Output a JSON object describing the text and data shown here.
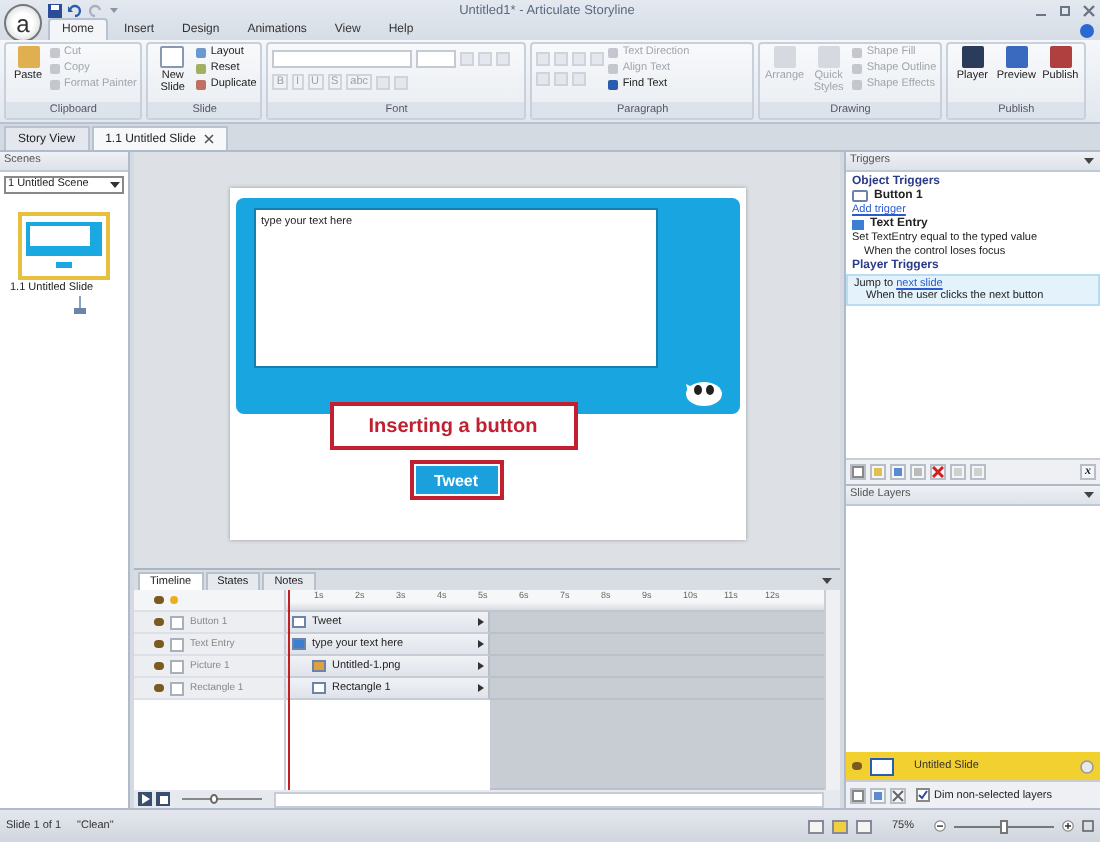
{
  "window": {
    "title": "Untitled1* - Articulate Storyline",
    "logo": "a"
  },
  "ribbon_tabs": [
    {
      "label": "Home",
      "selected": true
    },
    {
      "label": "Insert",
      "selected": false
    },
    {
      "label": "Design",
      "selected": false
    },
    {
      "label": "Animations",
      "selected": false
    },
    {
      "label": "View",
      "selected": false
    },
    {
      "label": "Help",
      "selected": false
    }
  ],
  "ribbon": {
    "clipboard": {
      "label": "Clipboard",
      "paste": "Paste",
      "small": [
        {
          "label": "Cut",
          "disabled": true
        },
        {
          "label": "Copy",
          "disabled": true
        },
        {
          "label": "Format Painter",
          "disabled": true
        }
      ]
    },
    "slide": {
      "label": "Slide",
      "new_slide": "New Slide",
      "small": [
        {
          "label": "Layout",
          "disabled": false
        },
        {
          "label": "Reset",
          "disabled": false
        },
        {
          "label": "Duplicate",
          "disabled": false
        }
      ]
    },
    "font": {
      "label": "Font",
      "buttons": [
        "B",
        "I",
        "U",
        "S",
        "abc"
      ]
    },
    "paragraph": {
      "label": "Paragraph",
      "small": [
        {
          "label": "Text Direction",
          "disabled": true
        },
        {
          "label": "Align Text",
          "disabled": true
        },
        {
          "label": "Find Text",
          "disabled": false
        }
      ]
    },
    "drawing": {
      "label": "Drawing",
      "large": [
        {
          "label": "Arrange",
          "disabled": true
        },
        {
          "label": "Quick Styles",
          "disabled": true
        }
      ],
      "small": [
        {
          "label": "Shape Fill",
          "disabled": true
        },
        {
          "label": "Shape Outline",
          "disabled": true
        },
        {
          "label": "Shape Effects",
          "disabled": true
        }
      ]
    },
    "publish": {
      "label": "Publish",
      "large": [
        {
          "label": "Player",
          "disabled": false
        },
        {
          "label": "Preview",
          "disabled": false
        },
        {
          "label": "Publish",
          "disabled": false
        }
      ]
    }
  },
  "doc_tabs": [
    {
      "label": "Story View",
      "selected": false
    },
    {
      "label": "1.1 Untitled Slide",
      "selected": true
    }
  ],
  "scenes": {
    "title": "Scenes",
    "scene": "1 Untitled Scene",
    "slides": [
      {
        "label": "1.1 Untitled Slide",
        "selected": true
      }
    ]
  },
  "slide": {
    "text_entry": "type your text here",
    "callout": "Inserting a button",
    "button": "Tweet"
  },
  "timeline": {
    "tabs": [
      {
        "label": "Timeline",
        "selected": true
      },
      {
        "label": "States",
        "selected": false
      },
      {
        "label": "Notes",
        "selected": false
      }
    ],
    "ticks": [
      "1s",
      "2s",
      "3s",
      "4s",
      "5s",
      "6s",
      "7s",
      "8s",
      "9s",
      "10s",
      "11s",
      "12s"
    ],
    "rows": [
      {
        "name": "Button 1",
        "label": "Tweet",
        "kind": "button",
        "locked": false
      },
      {
        "name": "Text Entry",
        "label": "type your text here",
        "kind": "entry",
        "locked": false,
        "children": [
          {
            "name": "Picture 1",
            "label": "Untitled-1.png",
            "kind": "picture",
            "locked": false
          },
          {
            "name": "Rectangle 1",
            "label": "Rectangle 1",
            "kind": "shape",
            "locked": false
          }
        ]
      }
    ],
    "zoom": {
      "level": 0.4
    }
  },
  "triggers": {
    "title": "Triggers",
    "object_heading": "Object Triggers",
    "object": "Button 1",
    "add_link": "Add trigger",
    "entry": "Text Entry",
    "entry_action": "Set TextEntry equal to the typed value",
    "entry_condition": "When the control loses focus",
    "player_heading": "Player Triggers",
    "player": [
      {
        "action": "Jump to",
        "link": "next slide",
        "condition": "When the user clicks the next button",
        "selected": true
      }
    ],
    "variables_button": "x"
  },
  "layers": {
    "title": "Slide Layers",
    "items": [
      {
        "label": "Untitled Slide",
        "selected": true
      }
    ],
    "dim": {
      "label": "Dim non-selected layers",
      "checked": true
    }
  },
  "status": {
    "slide": "Slide 1 of 1",
    "theme": "\"Clean\"",
    "zoom": "75%",
    "level": 0.5
  }
}
